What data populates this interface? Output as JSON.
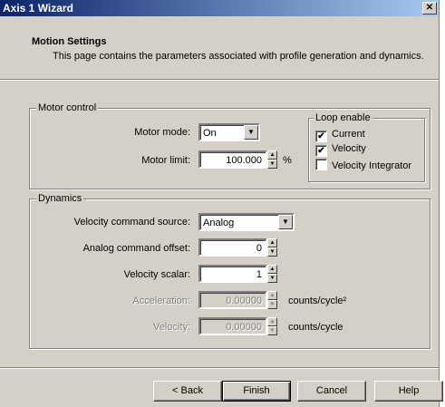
{
  "window": {
    "title": "Axis 1 Wizard",
    "close_glyph": "✕"
  },
  "header": {
    "title": "Motion Settings",
    "description": "This page contains the parameters associated with profile generation and dynamics."
  },
  "motor_control": {
    "group_label": "Motor control",
    "motor_mode_label": "Motor mode:",
    "motor_mode_value": "On",
    "motor_limit_label": "Motor limit:",
    "motor_limit_value": "100.000",
    "motor_limit_unit": "%"
  },
  "loop_enable": {
    "group_label": "Loop enable",
    "items": [
      {
        "label": "Current",
        "checked": true
      },
      {
        "label": "Velocity",
        "checked": true
      },
      {
        "label": "Velocity Integrator",
        "checked": false
      }
    ]
  },
  "dynamics": {
    "group_label": "Dynamics",
    "velocity_source_label": "Velocity command source:",
    "velocity_source_value": "Analog",
    "analog_offset_label": "Analog command offset:",
    "analog_offset_value": "0",
    "velocity_scalar_label": "Velocity scalar:",
    "velocity_scalar_value": "1",
    "acceleration_label": "Acceleration:",
    "acceleration_value": "0.00000",
    "acceleration_unit": "counts/cycle²",
    "velocity_label": "Velocity:",
    "velocity_value": "0.00000",
    "velocity_unit": "counts/cycle"
  },
  "buttons": {
    "back": "< Back",
    "finish": "Finish",
    "cancel": "Cancel",
    "help": "Help"
  },
  "glyphs": {
    "up": "▲",
    "down": "▼",
    "check": "✔"
  }
}
